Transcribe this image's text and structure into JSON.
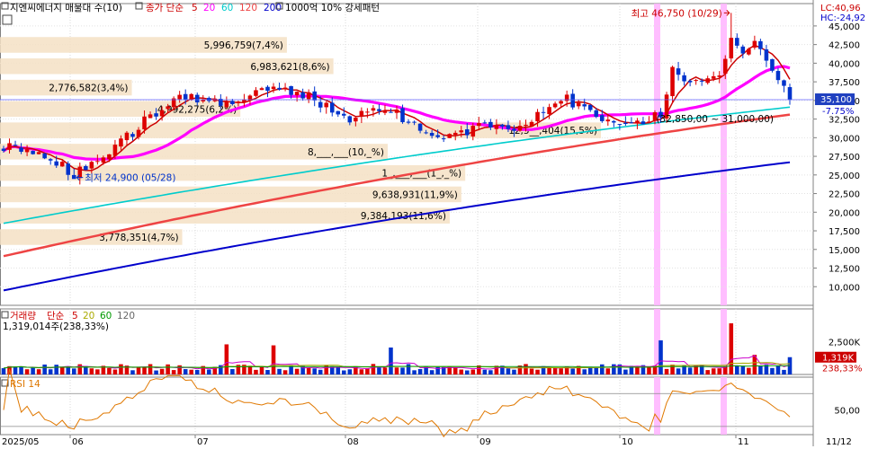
{
  "legend": {
    "main": {
      "prefix": "지엔씨에너지 매물대 수(10)",
      "ma_title": "종가 단순",
      "periods": [
        "5",
        "20",
        "60",
        "120",
        "200"
      ],
      "pattern": "1000억 10% 강세패턴"
    },
    "volume": {
      "title": "거래량",
      "ma_title": "단순",
      "periods": [
        "5",
        "20",
        "60",
        "120"
      ],
      "value": "1,319,014주(238,33%)"
    },
    "rsi": {
      "title": "RSI 14"
    }
  },
  "right_labels": {
    "lc": "LC:40,96",
    "hc": "HC:-24,92",
    "price": "35,100",
    "change": "-7.75%",
    "vol_value": "1,319K",
    "vol_pct": "238,33%"
  },
  "annotations": {
    "high": "최고 46,750 (10/29)",
    "low": "최저 24,900 (05/28)",
    "range": "(32,850,00 ~ 31,000,00)"
  },
  "volume_profile": [
    {
      "label": "5,996,759(7,4%)",
      "share": 0.074
    },
    {
      "label": "6,983,621(8,6%)",
      "share": 0.086
    },
    {
      "label": "2,776,582(3,4%)",
      "share": 0.034
    },
    {
      "label": "4,992,275(6,2%)",
      "share": 0.062
    },
    {
      "label": "12,5__,404(15,5%)",
      "share": 0.155
    },
    {
      "label": "8,___,___(10,_%)",
      "share": 0.1
    },
    {
      "label": "1_,___,___(1_,_%)",
      "share": 0.12
    },
    {
      "label": "9,638,931(11,9%)",
      "share": 0.119
    },
    {
      "label": "9,384,193(11,6%)",
      "share": 0.116
    },
    {
      "label": "3,778,351(4,7%)",
      "share": 0.047
    }
  ],
  "chart_data": [
    {
      "type": "candlestick",
      "title": "",
      "xlabel": "",
      "ylabel": "",
      "ylim": [
        7500,
        48000
      ],
      "yticks": [
        10000,
        12500,
        15000,
        17500,
        20000,
        22500,
        25000,
        27500,
        30000,
        32500,
        35000,
        37500,
        40000,
        42500,
        45000
      ],
      "ytick_labels": [
        "10,000",
        "12,500",
        "15,000",
        "17,500",
        "20,000",
        "22,500",
        "25,000",
        "27,500",
        "30,000",
        "32,500",
        "35,000",
        "37,500",
        "40,000",
        "42,500",
        "45,000"
      ],
      "x_month_labels": [
        "2025/05",
        "06",
        "07",
        "08",
        "09",
        "10",
        "11",
        "11/12"
      ],
      "highlight_dates": [
        "10/07",
        "10/29"
      ],
      "high": {
        "date": "10/29",
        "value": 46750
      },
      "low": {
        "date": "05/28",
        "value": 24900
      },
      "last_close": 35100,
      "colors": {
        "up": "#dd0000",
        "down": "#0033cc",
        "ma5": "#cc0000",
        "ma20": "#ff00ff",
        "ma60": "#00cccc",
        "ma120": "#ee4444",
        "ma200": "#0000cc",
        "highlight": "#ffb3ff"
      },
      "series": [
        {
          "period": "5"
        },
        {
          "period": "20"
        },
        {
          "period": "60",
          "start": 18500,
          "end": 34100
        },
        {
          "period": "120",
          "start": 14100,
          "end": 33100
        },
        {
          "period": "200",
          "start": 9500,
          "end": 26700
        }
      ]
    },
    {
      "type": "bar",
      "title": "",
      "xlabel": "",
      "ylabel": "",
      "ylim": [
        0,
        5000
      ],
      "yticks": [
        2500
      ],
      "ytick_labels": [
        "2,500K"
      ],
      "last_value_k": 1319
    },
    {
      "type": "line",
      "title": "",
      "xlabel": "",
      "ylabel": "",
      "ylim": [
        20,
        90
      ],
      "yticks": [
        50
      ],
      "ytick_labels": [
        "50,00"
      ],
      "reference_lines": [
        70,
        30
      ]
    }
  ]
}
